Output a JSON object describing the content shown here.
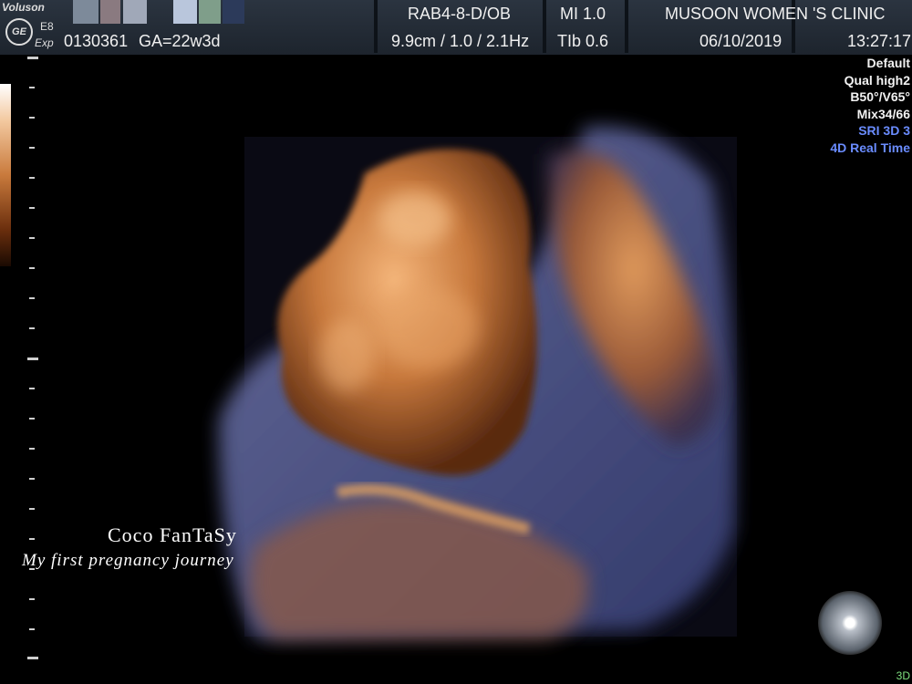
{
  "header": {
    "brand": "Voluson",
    "model": "E8",
    "exp": "Exp",
    "ge_logo": "GE",
    "probe": "RAB4-8-D/OB",
    "mi": "MI  1.0",
    "clinic": "MUSOON WOMEN 'S CLINIC",
    "patient_id": "0130361",
    "ga": "GA=22w3d",
    "depth_freq": "9.9cm / 1.0 / 2.1Hz",
    "tib": "TIb  0.6",
    "date": "06/10/2019",
    "time": "13:27:17"
  },
  "settings": {
    "lines": [
      "Default",
      "Qual high2",
      "B50°/V65°",
      "Mix34/66"
    ],
    "highlighted": [
      "SRI 3D 3",
      "4D Real Time"
    ]
  },
  "watermark": {
    "title": "Coco FanTaSy",
    "subtitle": "My first pregnancy journey"
  },
  "mode_label": "3D",
  "colors": {
    "header_bg": "#222a34",
    "accent_blue": "#6a8cff",
    "tissue_orange": "#d88a48",
    "tissue_blue": "#4a5a90"
  }
}
